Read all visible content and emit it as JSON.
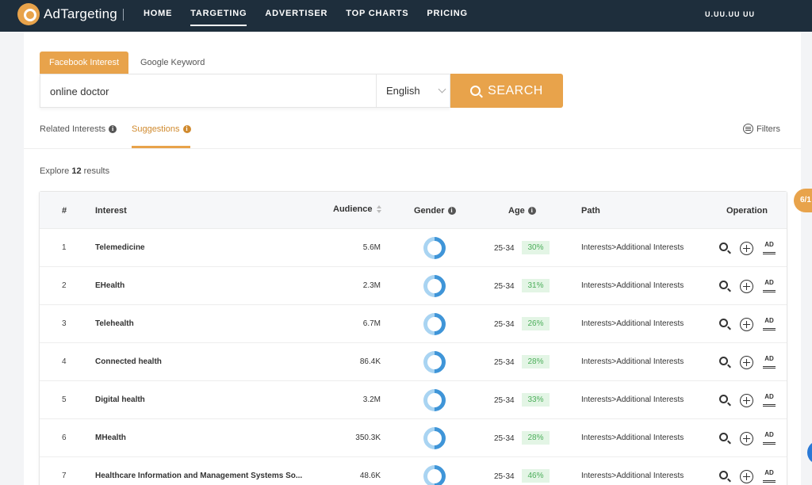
{
  "brand": {
    "name": "AdTargeting"
  },
  "nav": {
    "items": [
      "HOME",
      "TARGETING",
      "ADVERTISER",
      "TOP CHARTS",
      "PRICING"
    ],
    "active": "TARGETING",
    "account": "U.UU.UU UU"
  },
  "search": {
    "tabs": [
      "Facebook Interest",
      "Google Keyword"
    ],
    "query": "online doctor",
    "language": "English",
    "button": "SEARCH"
  },
  "subtabs": {
    "related": "Related Interests",
    "suggestions": "Suggestions",
    "filters": "Filters"
  },
  "results": {
    "prefix": "Explore",
    "count": "12",
    "suffix": "results"
  },
  "table": {
    "headers": {
      "idx": "#",
      "interest": "Interest",
      "audience": "Audience",
      "gender": "Gender",
      "age": "Age",
      "path": "Path",
      "operation": "Operation"
    },
    "rows": [
      {
        "idx": "1",
        "interest": "Telemedicine",
        "audience": "5.6M",
        "age_range": "25-34",
        "age_pct": "30%",
        "path": "Interests>Additional Interests"
      },
      {
        "idx": "2",
        "interest": "EHealth",
        "audience": "2.3M",
        "age_range": "25-34",
        "age_pct": "31%",
        "path": "Interests>Additional Interests"
      },
      {
        "idx": "3",
        "interest": "Telehealth",
        "audience": "6.7M",
        "age_range": "25-34",
        "age_pct": "26%",
        "path": "Interests>Additional Interests"
      },
      {
        "idx": "4",
        "interest": "Connected health",
        "audience": "86.4K",
        "age_range": "25-34",
        "age_pct": "28%",
        "path": "Interests>Additional Interests"
      },
      {
        "idx": "5",
        "interest": "Digital health",
        "audience": "3.2M",
        "age_range": "25-34",
        "age_pct": "33%",
        "path": "Interests>Additional Interests"
      },
      {
        "idx": "6",
        "interest": "MHealth",
        "audience": "350.3K",
        "age_range": "25-34",
        "age_pct": "28%",
        "path": "Interests>Additional Interests"
      },
      {
        "idx": "7",
        "interest": "Healthcare Information and Management Systems So...",
        "audience": "48.6K",
        "age_range": "25-34",
        "age_pct": "46%",
        "path": "Interests>Additional Interests"
      }
    ],
    "op_ad_label": "AD"
  },
  "pager": "6/1",
  "colors": {
    "accent": "#e8a34b",
    "nav_bg": "#1e2e3c",
    "age_green": "#4cae5a"
  }
}
